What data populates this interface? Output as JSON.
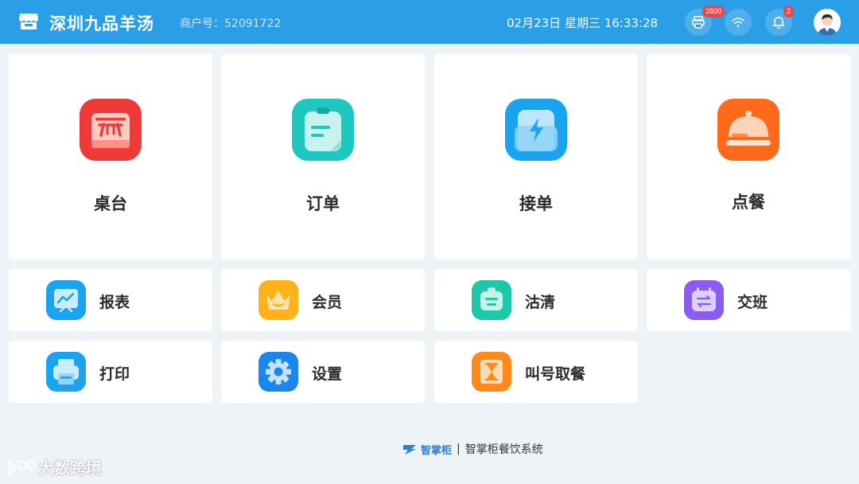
{
  "header": {
    "store_name": "深圳九品羊汤",
    "merchant_label": "商户号：52091722",
    "datetime": "02月23日  星期三  16:33:28",
    "printer_badge": "2800",
    "notification_badge": "2"
  },
  "main_tiles": [
    {
      "label": "桌台"
    },
    {
      "label": "订单"
    },
    {
      "label": "接单"
    },
    {
      "label": "点餐"
    }
  ],
  "small_tiles": [
    {
      "label": "报表"
    },
    {
      "label": "会员"
    },
    {
      "label": "沽清"
    },
    {
      "label": "交班"
    },
    {
      "label": "打印"
    },
    {
      "label": "设置"
    },
    {
      "label": "叫号取餐"
    }
  ],
  "footer": {
    "brand": "智掌柜",
    "separator": "|",
    "system_name": "智掌柜餐饮系统"
  },
  "watermark": {
    "text": "大数跨境"
  },
  "colors": {
    "header_bg": "#2a9ee6",
    "page_bg": "#eef3f8",
    "red": "#f03a3a",
    "teal": "#1ec7c0",
    "blue": "#1aa3ee",
    "orange": "#ff6a1a",
    "purple": "#8a5cf0",
    "yellow": "#ffb21a"
  }
}
